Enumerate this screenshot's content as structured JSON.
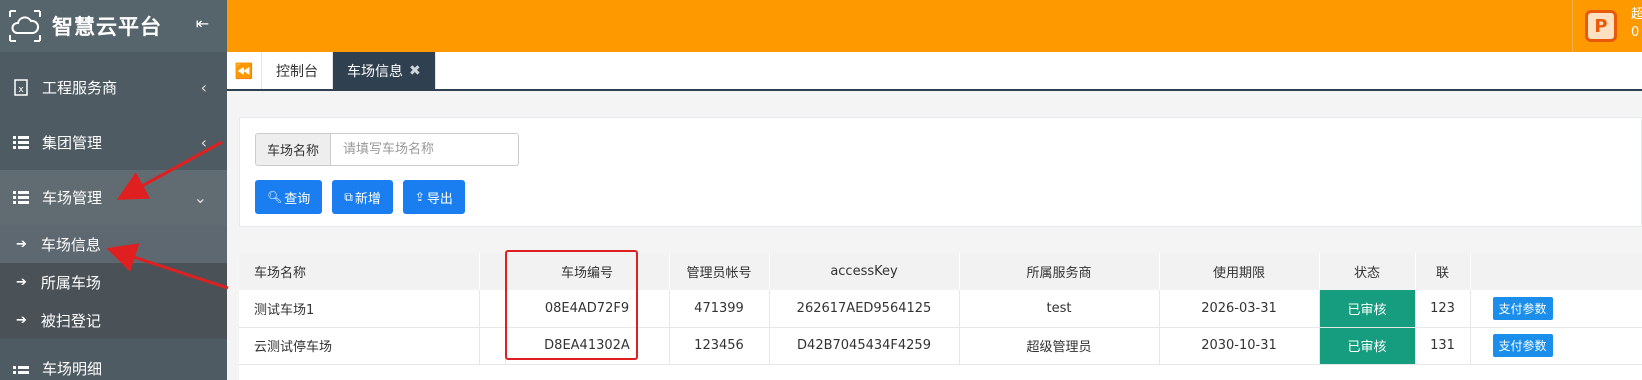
{
  "brand": {
    "title": "智慧云平台",
    "collapse_icon": "collapse-left-icon"
  },
  "sidebar": {
    "items": [
      {
        "label": "工程服务商",
        "icon": "excel-file-icon"
      },
      {
        "label": "集团管理",
        "icon": "list-icon"
      },
      {
        "label": "车场管理",
        "icon": "list-icon"
      },
      {
        "label": "车场明细",
        "icon": "list-icon"
      }
    ],
    "submenu": [
      {
        "label": "车场信息"
      },
      {
        "label": "所属车场"
      },
      {
        "label": "被扫登记"
      }
    ]
  },
  "topbar": {
    "user_line1": "超",
    "user_line2": "0"
  },
  "tabs": [
    {
      "label": "控制台"
    },
    {
      "label": "车场信息"
    }
  ],
  "search": {
    "label": "车场名称",
    "placeholder": "请填写车场名称",
    "buttons": {
      "query": "查询",
      "add": "新增",
      "export": "导出"
    }
  },
  "table": {
    "headers": [
      "车场名称",
      "",
      "车场编号",
      "管理员帐号",
      "accessKey",
      "所属服务商",
      "使用期限",
      "状态",
      "联",
      ""
    ],
    "rows": [
      {
        "name": "测试车场1",
        "code": "08E4AD72F9",
        "admin": "471399",
        "access_key": "262617AED9564125",
        "provider": "test",
        "expiry": "2026-03-31",
        "status": "已审核",
        "contact": "123",
        "action": "支付参数"
      },
      {
        "name": "云测试停车场",
        "code": "D8EA41302A",
        "admin": "123456",
        "access_key": "D42B7045434F4259",
        "provider": "超级管理员",
        "expiry": "2030-10-31",
        "status": "已审核",
        "contact": "131",
        "action": "支付参数"
      }
    ]
  },
  "colors": {
    "sidebar": "#4f5b63",
    "topbar": "#ff9900",
    "primary": "#1a7ef0",
    "status": "#169c7e",
    "annotation": "#e02020"
  }
}
